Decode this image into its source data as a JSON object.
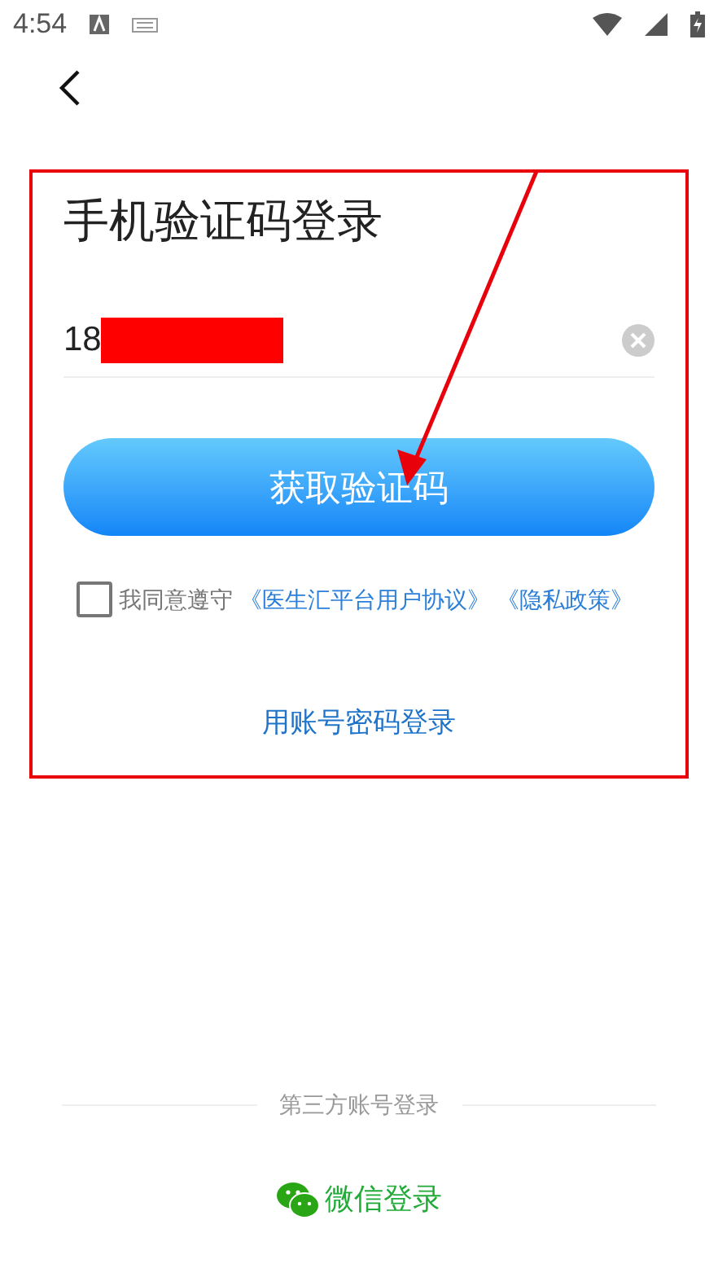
{
  "status_bar": {
    "time": "4:54"
  },
  "login": {
    "title": "手机验证码登录",
    "phone": {
      "value": "18",
      "redacted": true
    },
    "submit": "获取验证码",
    "agreement": {
      "checked": false,
      "prefix": "我同意遵守",
      "links": [
        "《医生汇平台用户协议》",
        "《隐私政策》"
      ]
    },
    "alternate_link": "用账号密码登录"
  },
  "third_party": {
    "heading": "第三方账号登录",
    "wechat": "微信登录"
  },
  "annotation": {
    "frame": true,
    "arrow": true
  }
}
